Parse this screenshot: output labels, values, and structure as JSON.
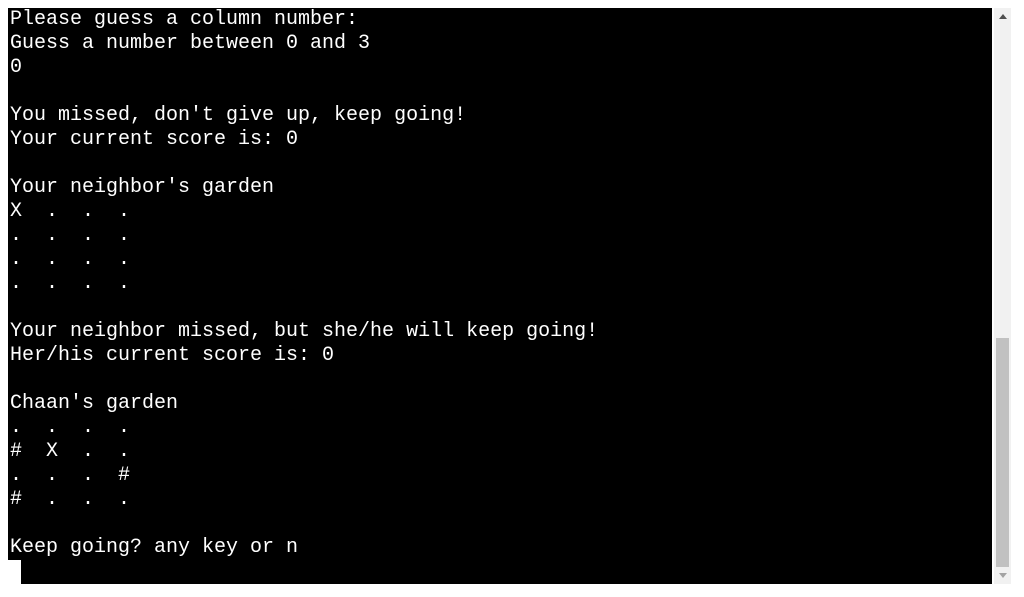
{
  "terminal": {
    "lines": [
      "Please guess a column number:",
      "Guess a number between 0 and 3",
      "0",
      "",
      "You missed, don't give up, keep going!",
      "Your current score is: 0",
      "",
      "Your neighbor's garden",
      "X  .  .  .",
      ".  .  .  .",
      ".  .  .  .",
      ".  .  .  .",
      "",
      "Your neighbor missed, but she/he will keep going!",
      "Her/his current score is: 0",
      "",
      "Chaan's garden",
      ".  .  .  .",
      "#  X  .  .",
      ".  .  .  #",
      "#  .  .  .",
      "",
      "Keep going? any key or n"
    ]
  },
  "scrollbar": {
    "position_fraction": 0.58
  }
}
